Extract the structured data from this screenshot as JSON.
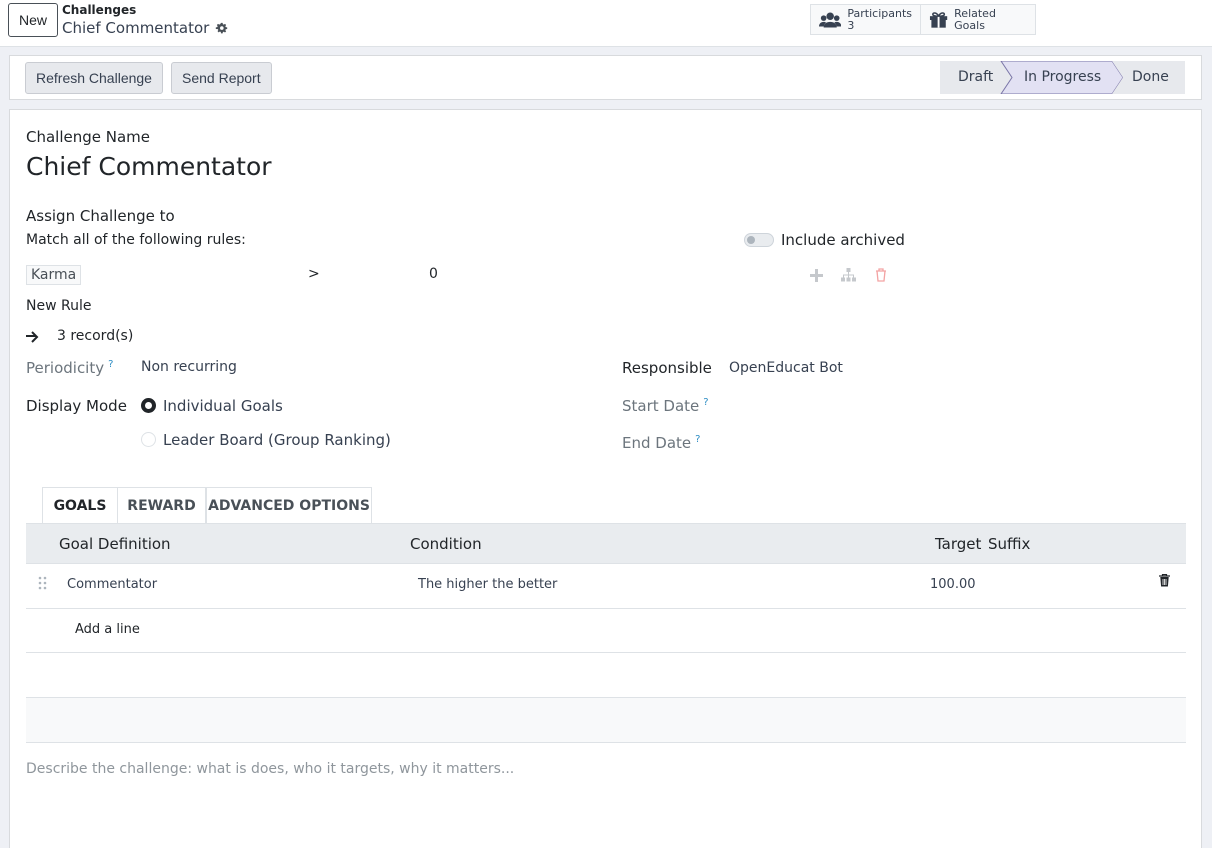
{
  "header": {
    "new_label": "New",
    "breadcrumb_parent": "Challenges",
    "breadcrumb_current": "Chief Commentator",
    "participants_label": "Participants",
    "participants_count": "3",
    "related_goals_label": "Related Goals"
  },
  "statusbar": {
    "refresh_label": "Refresh Challenge",
    "send_report_label": "Send Report",
    "stages": [
      "Draft",
      "In Progress",
      "Done"
    ],
    "active_stage": "In Progress"
  },
  "form": {
    "name_label": "Challenge Name",
    "name_value": "Chief Commentator",
    "assign_label": "Assign Challenge to",
    "match_rule_text": "Match all of the following rules:",
    "include_archived_label": "Include archived",
    "rule": {
      "field": "Karma",
      "operator": ">",
      "value": "0"
    },
    "new_rule_label": "New Rule",
    "records_text": "3 record(s)",
    "periodicity_label": "Periodicity",
    "periodicity_value": "Non recurring",
    "responsible_label": "Responsible",
    "responsible_value": "OpenEducat Bot",
    "display_mode_label": "Display Mode",
    "display_mode_options": [
      "Individual Goals",
      "Leader Board (Group Ranking)"
    ],
    "display_mode_selected": "Individual Goals",
    "start_date_label": "Start Date",
    "end_date_label": "End Date",
    "help_mark": "?"
  },
  "tabs": [
    "GOALS",
    "REWARD",
    "ADVANCED OPTIONS"
  ],
  "goals_table": {
    "columns": [
      "Goal Definition",
      "Condition",
      "Target",
      "Suffix"
    ],
    "rows": [
      {
        "goal_definition": "Commentator",
        "condition": "The higher the better",
        "target": "100.00",
        "suffix": ""
      }
    ],
    "add_line_label": "Add a line"
  },
  "description_placeholder": "Describe the challenge: what is does, who it targets, why it matters...",
  "colors": {
    "accent": "#2f8ec4",
    "active_stage": "#e2e1f3",
    "danger_icon": "#f3a3a3"
  }
}
